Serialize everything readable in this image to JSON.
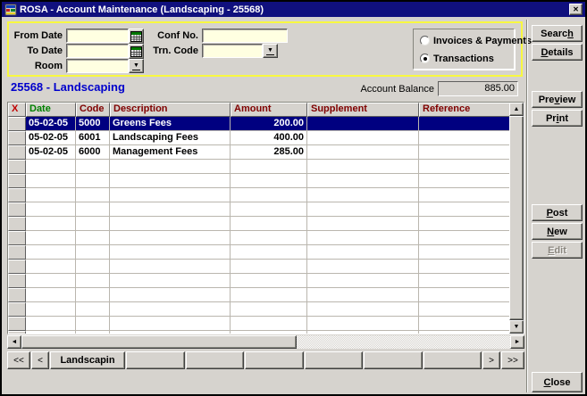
{
  "window": {
    "title": "ROSA - Account Maintenance (Landscaping - 25568)"
  },
  "icons": {
    "close": "✕",
    "dropdown_arrow": "▼",
    "scroll_up": "▲",
    "scroll_down": "▼",
    "scroll_left": "◄",
    "scroll_right": "►"
  },
  "filters": {
    "from_date_label": "From Date",
    "from_date_value": "",
    "to_date_label": "To Date",
    "to_date_value": "",
    "room_label": "Room",
    "room_value": "",
    "conf_no_label": "Conf No.",
    "conf_no_value": "",
    "trn_code_label": "Trn. Code",
    "trn_code_value": "",
    "view_options": [
      {
        "label": "Invoices & Payments",
        "selected": false
      },
      {
        "label": "Transactions",
        "selected": true
      }
    ]
  },
  "account": {
    "title": "25568 - Landscaping",
    "balance_label": "Account Balance",
    "balance_value": "885.00"
  },
  "table": {
    "headers": [
      {
        "label": "X",
        "color": "#c00000"
      },
      {
        "label": "Date",
        "color": "#008000"
      },
      {
        "label": "Code",
        "color": "#800000"
      },
      {
        "label": "Description",
        "color": "#800000"
      },
      {
        "label": "Amount",
        "color": "#800000"
      },
      {
        "label": "Supplement",
        "color": "#800000"
      },
      {
        "label": "Reference",
        "color": "#800000"
      }
    ],
    "rows": [
      {
        "date": "05-02-05",
        "code": "5000",
        "description": "Greens Fees",
        "amount": "200.00",
        "supplement": "",
        "reference": "",
        "selected": true
      },
      {
        "date": "05-02-05",
        "code": "6001",
        "description": "Landscaping Fees",
        "amount": "400.00",
        "supplement": "",
        "reference": "",
        "selected": false
      },
      {
        "date": "05-02-05",
        "code": "6000",
        "description": "Management Fees",
        "amount": "285.00",
        "supplement": "",
        "reference": "",
        "selected": false
      }
    ],
    "visible_empty_rows": 13
  },
  "actions": {
    "search": {
      "label": "Search",
      "key": "h"
    },
    "details": {
      "label": "Details",
      "key": "D"
    },
    "preview": {
      "label": "Preview",
      "key": "v"
    },
    "print": {
      "label": "Print",
      "key": "i"
    },
    "post": {
      "label": "Post",
      "key": "P"
    },
    "new": {
      "label": "New",
      "key": "N"
    },
    "edit": {
      "label": "Edit",
      "key": "E",
      "disabled": true
    },
    "close": {
      "label": "Close",
      "key": "C"
    }
  },
  "tabbar": {
    "first": "<<",
    "prev": "<",
    "active_tab": "Landscapin",
    "empty_tab_count": 6,
    "next": ">",
    "last": ">>"
  },
  "colors": {
    "titlebar": "#10107e",
    "selection": "#000080",
    "input_bg": "#ffffe1",
    "panel_border": "#f8f840",
    "accent_blue": "#0000cc"
  }
}
